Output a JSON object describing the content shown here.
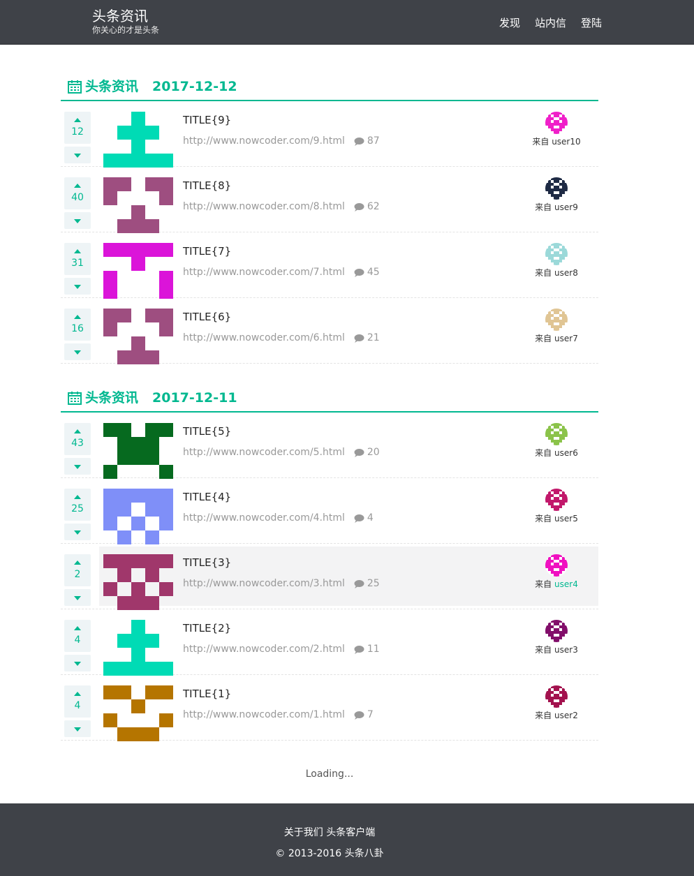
{
  "header": {
    "title": "头条资讯",
    "subtitle": "你关心的才是头条",
    "nav": [
      "发现",
      "站内信",
      "登陆"
    ]
  },
  "from_label": "来自",
  "days": [
    {
      "site": "头条资讯",
      "date": "2017-12-12",
      "items": [
        {
          "votes": "12",
          "title": "TITLE{9}",
          "link": "http://www.nowcoder.com/9.html",
          "comments": "87",
          "user": "user10",
          "thumb_color": "#00dbb5",
          "thumb_pattern": "cross",
          "avatar_color": "#f020c9"
        },
        {
          "votes": "40",
          "title": "TITLE{8}",
          "link": "http://www.nowcoder.com/8.html",
          "comments": "62",
          "user": "user9",
          "thumb_color": "#9e4e80",
          "thumb_pattern": "face",
          "avatar_color": "#1e2a44"
        },
        {
          "votes": "31",
          "title": "TITLE{7}",
          "link": "http://www.nowcoder.com/7.html",
          "comments": "45",
          "user": "user8",
          "thumb_color": "#db14d9",
          "thumb_pattern": "ybar",
          "avatar_color": "#9bd9d9"
        },
        {
          "votes": "16",
          "title": "TITLE{6}",
          "link": "http://www.nowcoder.com/6.html",
          "comments": "21",
          "user": "user7",
          "thumb_color": "#9e4e80",
          "thumb_pattern": "face",
          "avatar_color": "#e0c594"
        }
      ]
    },
    {
      "site": "头条资讯",
      "date": "2017-12-11",
      "items": [
        {
          "votes": "43",
          "title": "TITLE{5}",
          "link": "http://www.nowcoder.com/5.html",
          "comments": "20",
          "user": "user6",
          "thumb_color": "#066a1f",
          "thumb_pattern": "invader",
          "avatar_color": "#8bc34a"
        },
        {
          "votes": "25",
          "title": "TITLE{4}",
          "link": "http://www.nowcoder.com/4.html",
          "comments": "4",
          "user": "user5",
          "thumb_color": "#7f8ff8",
          "thumb_pattern": "robot",
          "avatar_color": "#c2186b"
        },
        {
          "votes": "2",
          "title": "TITLE{3}",
          "link": "http://www.nowcoder.com/3.html",
          "comments": "25",
          "user": "user4",
          "thumb_color": "#a0376b",
          "thumb_pattern": "checker",
          "avatar_color": "#f010c0"
        },
        {
          "votes": "4",
          "title": "TITLE{2}",
          "link": "http://www.nowcoder.com/2.html",
          "comments": "11",
          "user": "user3",
          "thumb_color": "#00dbb5",
          "thumb_pattern": "cross",
          "avatar_color": "#820e6a"
        },
        {
          "votes": "4",
          "title": "TITLE{1}",
          "link": "http://www.nowcoder.com/1.html",
          "comments": "7",
          "user": "user2",
          "thumb_color": "#b57500",
          "thumb_pattern": "smile",
          "avatar_color": "#a3124e"
        }
      ]
    }
  ],
  "loading": "Loading...",
  "footer": {
    "links": [
      "关于我们",
      "头条客户端"
    ],
    "copyright": "© 2013-2016 头条八卦"
  },
  "colors": {
    "accent": "#00b890",
    "header_bg": "#3f4248"
  }
}
